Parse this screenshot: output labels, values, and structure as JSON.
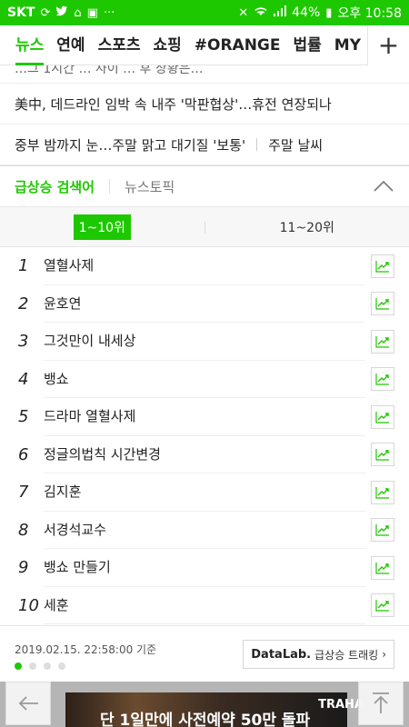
{
  "status_bar": {
    "carrier": "SKT",
    "battery": "44%",
    "time": "오후 10:58"
  },
  "tabs": [
    {
      "label": "뉴스",
      "active": true
    },
    {
      "label": "연예"
    },
    {
      "label": "스포츠"
    },
    {
      "label": "쇼핑"
    },
    {
      "label": "#ORANGE"
    },
    {
      "label": "법률"
    },
    {
      "label": "MY"
    }
  ],
  "news": {
    "partial_line": "…그 1시간 … 사이 … 후 상황은…",
    "items": [
      {
        "headline": "美中, 데드라인 임박 속 내주 '막판협상'…휴전 연장되나"
      },
      {
        "headline": "중부 밤까지 눈…주말 맑고 대기질 '보통'",
        "tag": "주말 날씨"
      }
    ]
  },
  "trending": {
    "tab_active": "급상승 검색어",
    "tab_other": "뉴스토픽",
    "range_active": "1~10위",
    "range_other": "11~20위",
    "items": [
      {
        "rank": "1",
        "keyword": "열혈사제"
      },
      {
        "rank": "2",
        "keyword": "윤호연"
      },
      {
        "rank": "3",
        "keyword": "그것만이 내세상"
      },
      {
        "rank": "4",
        "keyword": "뱅쇼"
      },
      {
        "rank": "5",
        "keyword": "드라마 열혈사제"
      },
      {
        "rank": "6",
        "keyword": "정글의법칙 시간변경"
      },
      {
        "rank": "7",
        "keyword": "김지훈"
      },
      {
        "rank": "8",
        "keyword": "서경석교수"
      },
      {
        "rank": "9",
        "keyword": "뱅쇼 만들기"
      },
      {
        "rank": "10",
        "keyword": "세훈"
      }
    ],
    "timestamp": "2019.02.15. 22:58:00 기준",
    "datalab_brand": "DataLab.",
    "datalab_text": "급상승 트래킹",
    "page_dots": 4,
    "active_dot": 0
  },
  "banner": {
    "text": "단 1일만에 사전예약 50만 돌파",
    "brand": "TRAHA"
  },
  "colors": {
    "accent": "#1ec800"
  },
  "icons": {
    "plus": "plus-icon",
    "collapse": "chevron-up-icon",
    "trend": "trend-chart-icon",
    "back": "back-arrow-icon",
    "top": "scroll-top-icon"
  }
}
